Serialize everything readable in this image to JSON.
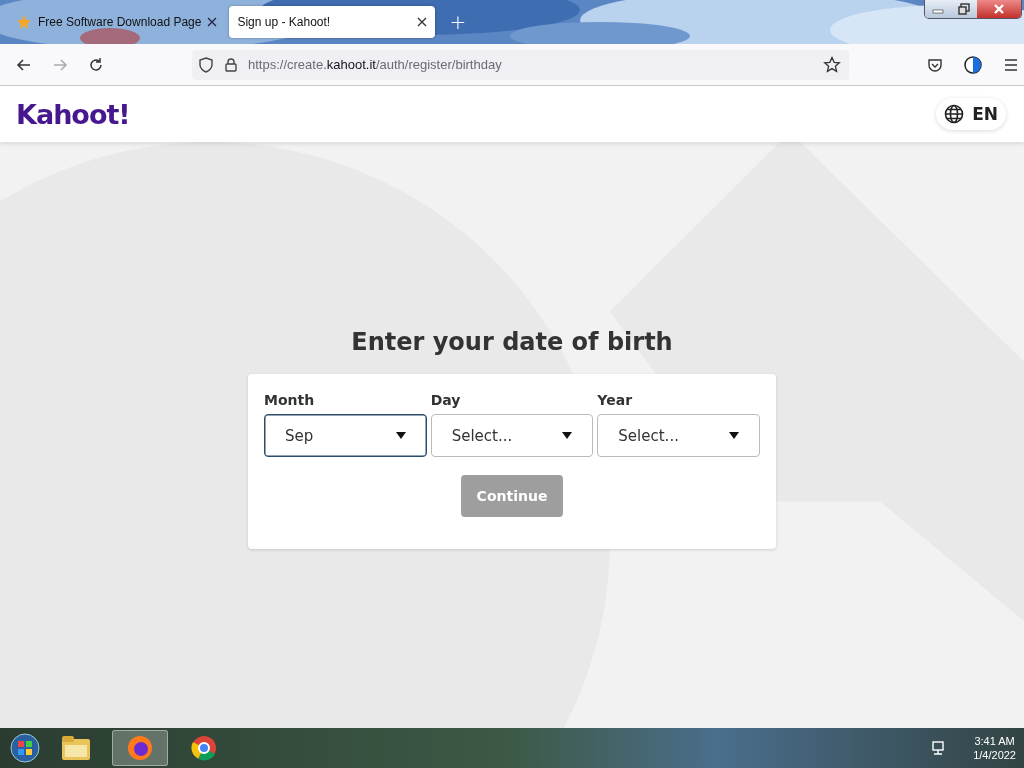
{
  "browser": {
    "tabs": [
      {
        "title": "Free Software Download Page",
        "selected": false,
        "favicon": true
      },
      {
        "title": "Sign up - Kahoot!",
        "selected": true,
        "favicon": false
      }
    ],
    "new_tab": "+",
    "url": {
      "prefix": "https://create.",
      "domain": "kahoot.it",
      "path": "/auth/register/birthday"
    }
  },
  "header": {
    "logo": "Kahoot!",
    "language": "EN"
  },
  "form": {
    "title": "Enter your date of birth",
    "fields": [
      {
        "label": "Month",
        "value": "Sep",
        "focused": true
      },
      {
        "label": "Day",
        "placeholder": "Select...",
        "focused": false
      },
      {
        "label": "Year",
        "placeholder": "Select...",
        "focused": false
      }
    ],
    "button": {
      "label": "Continue",
      "disabled": true
    }
  },
  "taskbar": {
    "time": "3:41 AM",
    "date": "1/4/2022"
  }
}
